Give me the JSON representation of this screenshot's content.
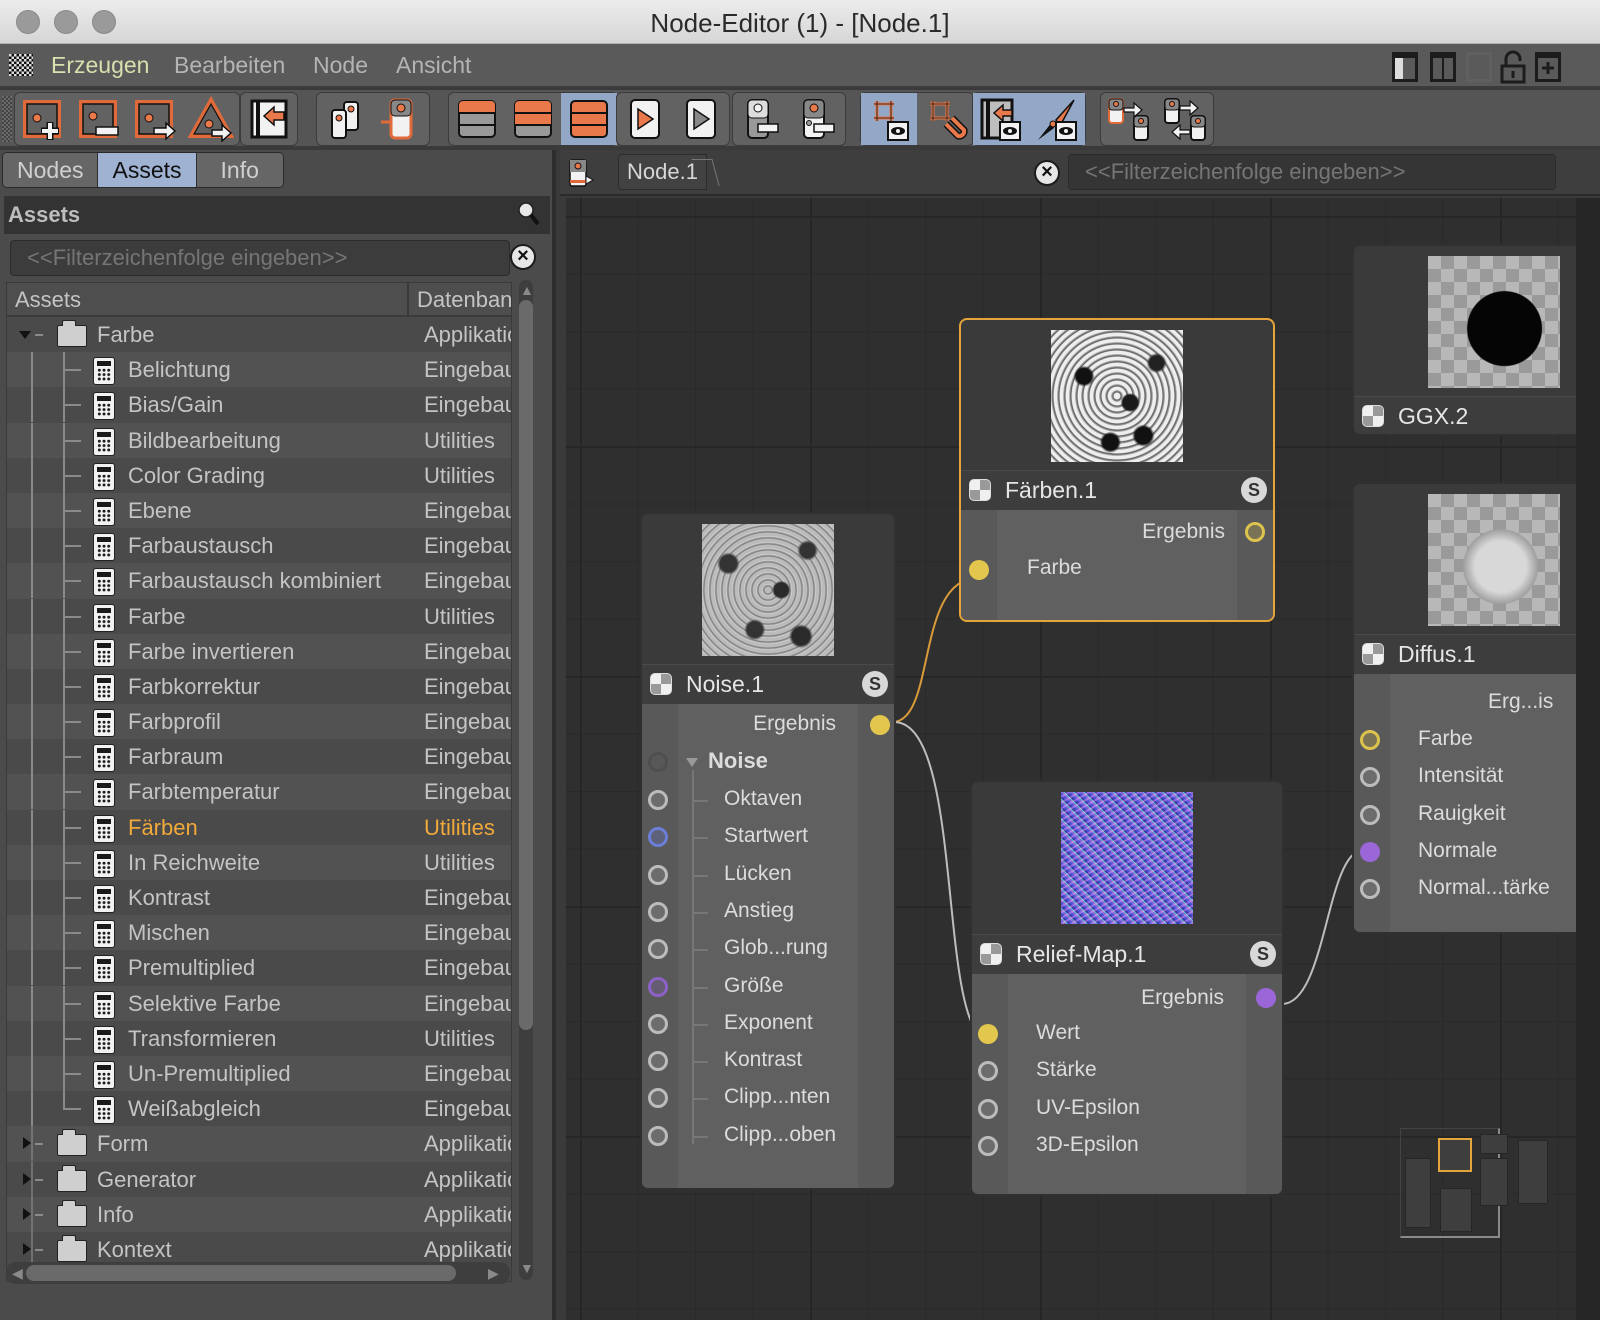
{
  "window": {
    "title": "Node-Editor (1) - [Node.1]",
    "traffic_lights": [
      "close",
      "minimize",
      "zoom"
    ]
  },
  "menubar": {
    "items": [
      {
        "label": "Erzeugen",
        "active": true
      },
      {
        "label": "Bearbeiten",
        "active": false
      },
      {
        "label": "Node",
        "active": false
      },
      {
        "label": "Ansicht",
        "active": false
      }
    ],
    "right_icons": [
      "layout-single-icon",
      "layout-split-icon",
      "layout-disabled-icon",
      "unlock-icon",
      "new-window-icon"
    ]
  },
  "toolbar": {
    "groups": [
      [
        "add-node-icon",
        "remove-node-icon",
        "move-node-icon",
        "add-asset-icon"
      ],
      [
        "import-icon"
      ],
      [
        "group-nodes-icon",
        "node-port-icon"
      ],
      [
        "collapse-none-icon",
        "collapse-partial-icon",
        "expand-all-icon"
      ],
      [
        "play-orange-icon",
        "play-gray-icon"
      ],
      [
        "port-out-icon",
        "port-in-icon"
      ],
      [
        "frame-view-icon",
        "frame-magnet-icon"
      ],
      [
        "back-view-icon",
        "pointer-view-icon"
      ],
      [
        "move-port-icon",
        "swap-ports-icon"
      ]
    ],
    "selected": [
      "expand-all-icon",
      "frame-view-icon",
      "back-view-icon",
      "pointer-view-icon"
    ]
  },
  "left_panel": {
    "tabs": [
      {
        "label": "Nodes",
        "active": false
      },
      {
        "label": "Assets",
        "active": true
      },
      {
        "label": "Info",
        "active": false
      }
    ],
    "section_title": "Assets",
    "filter_placeholder": "<<Filterzeichenfolge eingeben>>",
    "columns": [
      "Assets",
      "Datenbank"
    ],
    "tree": [
      {
        "type": "folder",
        "name": "Farbe",
        "db": "Applikation",
        "expanded": true
      },
      {
        "type": "item",
        "name": "Belichtung",
        "db": "Eingebaut"
      },
      {
        "type": "item",
        "name": "Bias/Gain",
        "db": "Eingebaut"
      },
      {
        "type": "item",
        "name": "Bildbearbeitung",
        "db": "Utilities"
      },
      {
        "type": "item",
        "name": "Color Grading",
        "db": "Utilities"
      },
      {
        "type": "item",
        "name": "Ebene",
        "db": "Eingebaut"
      },
      {
        "type": "item",
        "name": "Farbaustausch",
        "db": "Eingebaut"
      },
      {
        "type": "item",
        "name": "Farbaustausch kombiniert",
        "db": "Eingebaut"
      },
      {
        "type": "item",
        "name": "Farbe",
        "db": "Utilities"
      },
      {
        "type": "item",
        "name": "Farbe invertieren",
        "db": "Eingebaut"
      },
      {
        "type": "item",
        "name": "Farbkorrektur",
        "db": "Eingebaut"
      },
      {
        "type": "item",
        "name": "Farbprofil",
        "db": "Eingebaut"
      },
      {
        "type": "item",
        "name": "Farbraum",
        "db": "Eingebaut"
      },
      {
        "type": "item",
        "name": "Farbtemperatur",
        "db": "Eingebaut"
      },
      {
        "type": "item",
        "name": "Färben",
        "db": "Utilities",
        "highlight": true
      },
      {
        "type": "item",
        "name": "In Reichweite",
        "db": "Utilities"
      },
      {
        "type": "item",
        "name": "Kontrast",
        "db": "Eingebaut"
      },
      {
        "type": "item",
        "name": "Mischen",
        "db": "Eingebaut"
      },
      {
        "type": "item",
        "name": "Premultiplied",
        "db": "Eingebaut"
      },
      {
        "type": "item",
        "name": "Selektive Farbe",
        "db": "Eingebaut"
      },
      {
        "type": "item",
        "name": "Transformieren",
        "db": "Utilities"
      },
      {
        "type": "item",
        "name": "Un-Premultiplied",
        "db": "Eingebaut"
      },
      {
        "type": "item",
        "name": "Weißabgleich",
        "db": "Eingebaut",
        "last": true
      },
      {
        "type": "folder",
        "name": "Form",
        "db": "Applikation",
        "expanded": false
      },
      {
        "type": "folder",
        "name": "Generator",
        "db": "Applikation",
        "expanded": false
      },
      {
        "type": "folder",
        "name": "Info",
        "db": "Applikation",
        "expanded": false
      },
      {
        "type": "folder",
        "name": "Kontext",
        "db": "Applikation",
        "expanded": false
      }
    ]
  },
  "editor": {
    "breadcrumb": "Node.1",
    "filter_placeholder": "<<Filterzeichenfolge eingeben>>",
    "nodes": {
      "noise": {
        "title": "Noise.1",
        "solo": "S",
        "output": "Ergebnis",
        "group": "Noise",
        "inputs": [
          "Oktaven",
          "Startwert",
          "Lücken",
          "Anstieg",
          "Glob...rung",
          "Größe",
          "Exponent",
          "Kontrast",
          "Clipp...nten",
          "Clipp...oben"
        ]
      },
      "faerben": {
        "title": "Färben.1",
        "solo": "S",
        "output": "Ergebnis",
        "inputs": [
          "Farbe"
        ],
        "selected": true
      },
      "relief": {
        "title": "Relief-Map.1",
        "solo": "S",
        "output": "Ergebnis",
        "inputs": [
          "Wert",
          "Stärke",
          "UV-Epsilon",
          "3D-Epsilon"
        ]
      },
      "ggx": {
        "title": "GGX.2"
      },
      "diffus": {
        "title": "Diffus.1",
        "output": "Erg...is",
        "inputs": [
          "Farbe",
          "Intensität",
          "Rauigkeit",
          "Normale",
          "Normal...tärke"
        ]
      }
    },
    "colors": {
      "wire_orange": "#d99a3a",
      "wire_gray": "#bdbdbd",
      "port_yellow": "#e2c64e",
      "port_purple": "#9b66d8",
      "selection": "#e6a53a"
    }
  }
}
